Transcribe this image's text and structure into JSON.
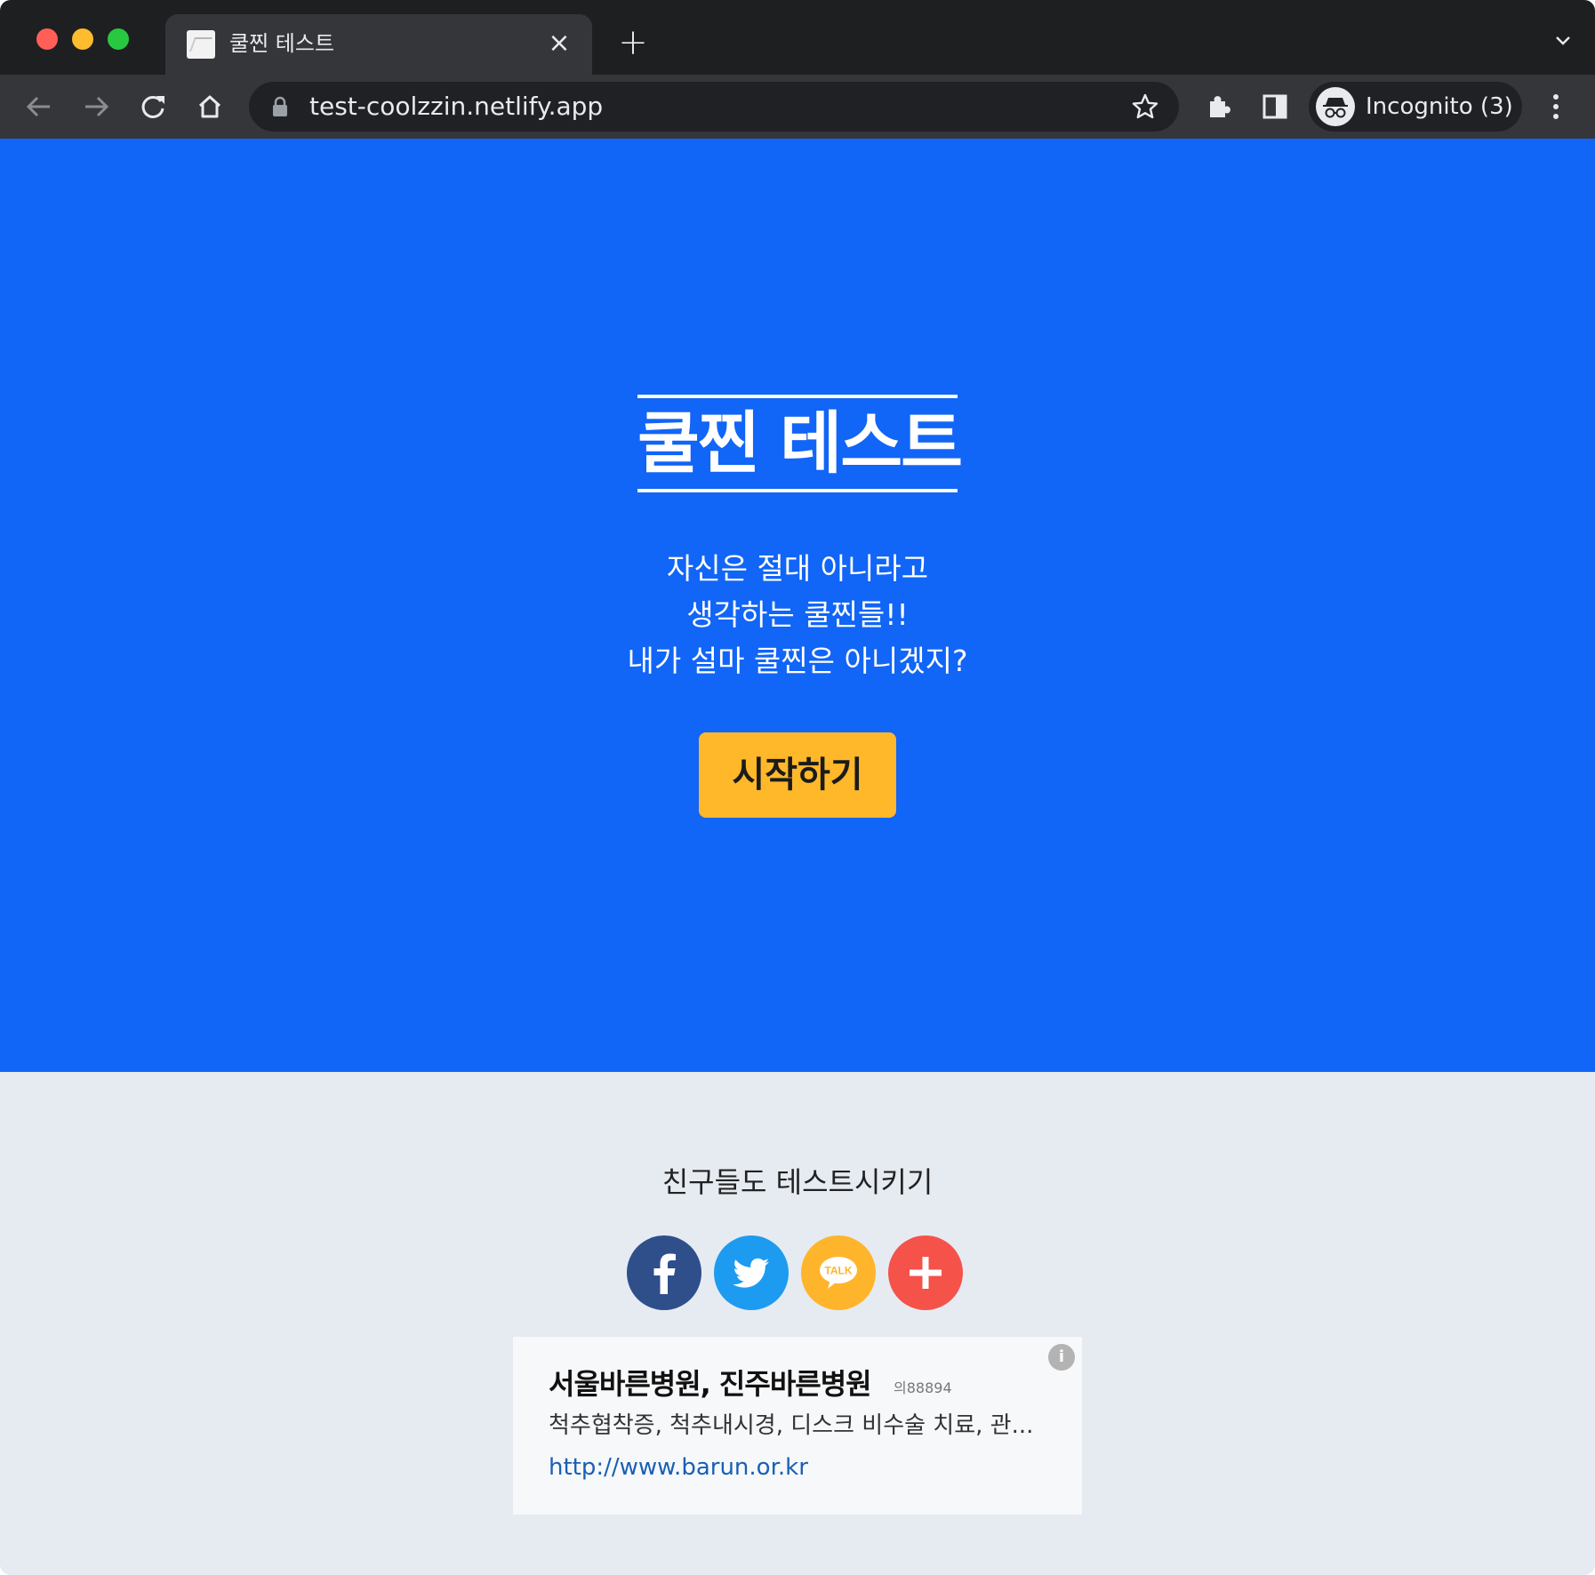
{
  "browser": {
    "tab_title": "쿨찐 테스트",
    "url": "test-coolzzin.netlify.app",
    "profile_label": "Incognito (3)"
  },
  "hero": {
    "title": "쿨찐 테스트",
    "lines": [
      "자신은 절대 아니라고",
      "생각하는 쿨찐들!!",
      "내가 설마 쿨찐은 아니겠지?"
    ],
    "start_button": "시작하기"
  },
  "share": {
    "title": "친구들도 테스트시키기",
    "kakao_label": "TALK"
  },
  "ad": {
    "title": "서울바른병원, 진주바른병원",
    "code": "의88894",
    "description": "척추협착증, 척추내시경, 디스크 비수술 치료, 관...",
    "url": "http://www.barun.or.kr",
    "info_glyph": "i"
  },
  "colors": {
    "hero_bg": "#1165f7",
    "start_button_bg": "#ffb829",
    "share_bg": "#e6ebf2",
    "facebook": "#2f4f8b",
    "twitter": "#1d9bf0",
    "kakao": "#ffb52b",
    "more": "#f5524a"
  }
}
